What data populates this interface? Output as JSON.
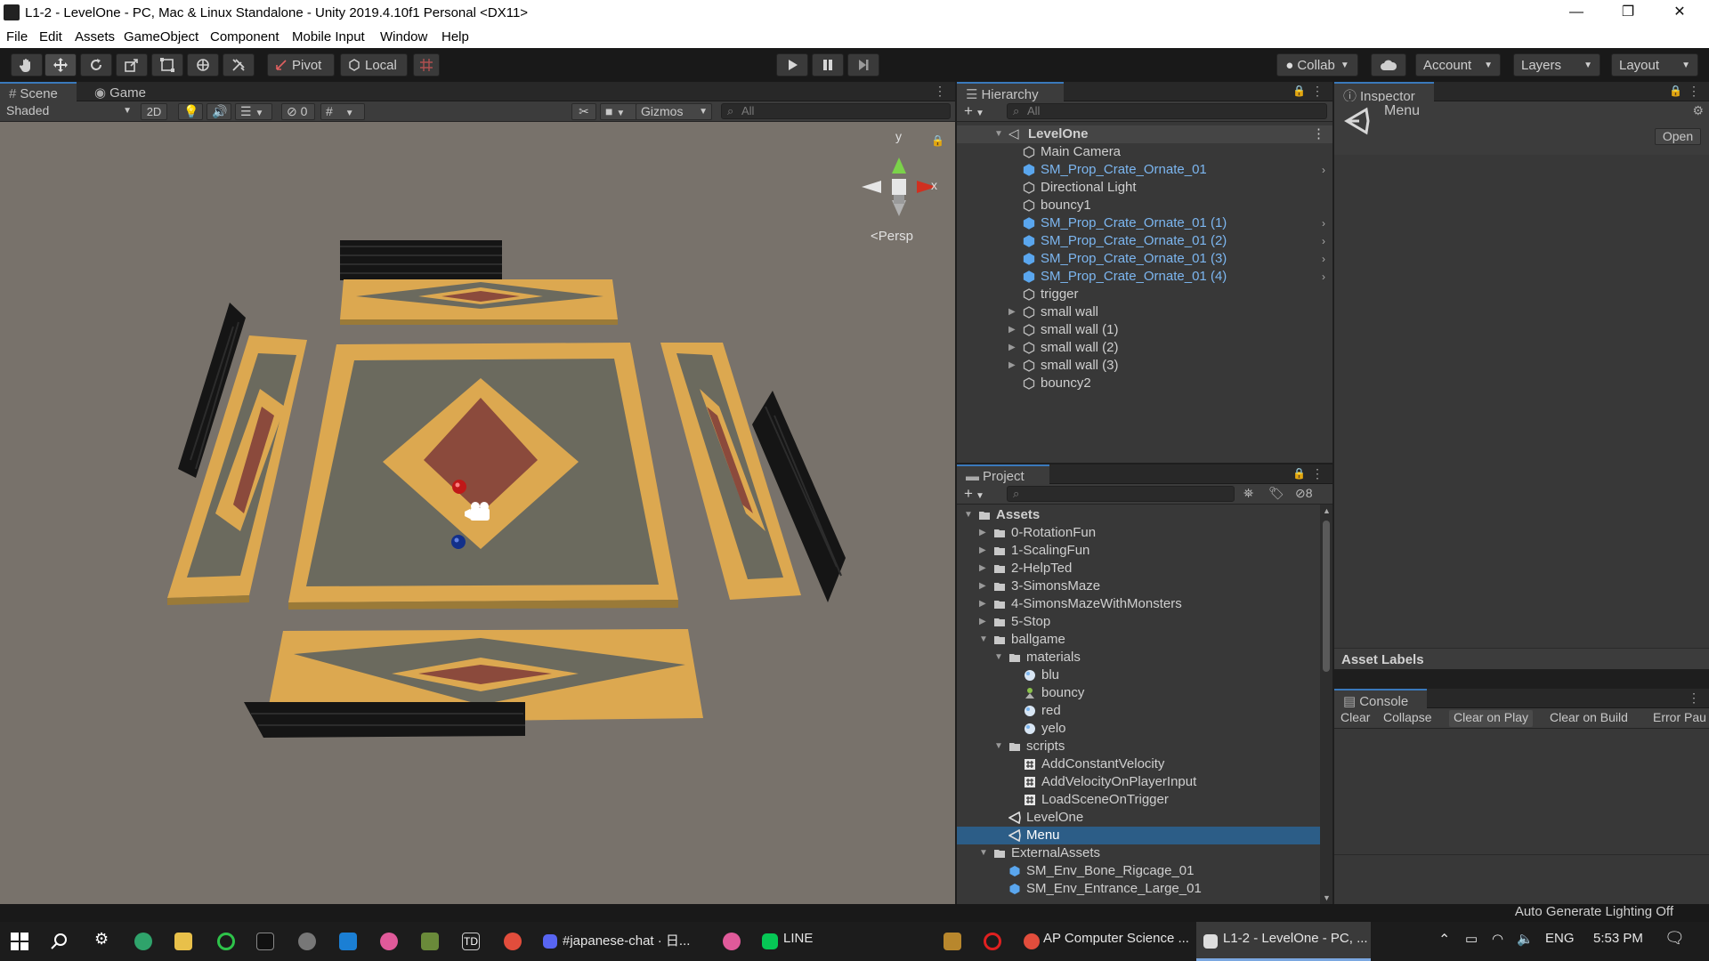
{
  "window": {
    "title": "L1-2 - LevelOne - PC, Mac & Linux Standalone - Unity 2019.4.10f1 Personal <DX11>",
    "minimize": "—",
    "maximize": "❐",
    "close": "✕"
  },
  "menu": [
    "File",
    "Edit",
    "Assets",
    "GameObject",
    "Component",
    "Mobile Input",
    "Window",
    "Help"
  ],
  "toolbar": {
    "pivot": "Pivot",
    "local": "Local",
    "collab": "Collab",
    "account": "Account",
    "layers": "Layers",
    "layout": "Layout"
  },
  "scene": {
    "tab_scene": "Scene",
    "tab_game": "Game",
    "shading": "Shaded",
    "mode2d": "2D",
    "hidden_count": "0",
    "gizmos": "Gizmos",
    "search_placeholder": "All",
    "persp": "Persp",
    "axis_y": "y",
    "axis_x": "x"
  },
  "hierarchy": {
    "tab": "Hierarchy",
    "search_placeholder": "All",
    "scene": "LevelOne",
    "items": [
      {
        "name": "Main Camera",
        "prefab": false,
        "expandable": false
      },
      {
        "name": "SM_Prop_Crate_Ornate_01",
        "prefab": true,
        "expandable": false
      },
      {
        "name": "Directional Light",
        "prefab": false,
        "expandable": false
      },
      {
        "name": "bouncy1",
        "prefab": false,
        "expandable": false
      },
      {
        "name": "SM_Prop_Crate_Ornate_01 (1)",
        "prefab": true,
        "expandable": false
      },
      {
        "name": "SM_Prop_Crate_Ornate_01 (2)",
        "prefab": true,
        "expandable": false
      },
      {
        "name": "SM_Prop_Crate_Ornate_01 (3)",
        "prefab": true,
        "expandable": false
      },
      {
        "name": "SM_Prop_Crate_Ornate_01 (4)",
        "prefab": true,
        "expandable": false
      },
      {
        "name": "trigger",
        "prefab": false,
        "expandable": false
      },
      {
        "name": "small wall",
        "prefab": false,
        "expandable": true
      },
      {
        "name": "small wall (1)",
        "prefab": false,
        "expandable": true
      },
      {
        "name": "small wall (2)",
        "prefab": false,
        "expandable": true
      },
      {
        "name": "small wall (3)",
        "prefab": false,
        "expandable": true
      },
      {
        "name": "bouncy2",
        "prefab": false,
        "expandable": false
      }
    ]
  },
  "project": {
    "tab": "Project",
    "hidden_count": "8",
    "tree": [
      {
        "name": "Assets",
        "depth": 0,
        "kind": "folder",
        "open": true
      },
      {
        "name": "0-RotationFun",
        "depth": 1,
        "kind": "folder",
        "open": false
      },
      {
        "name": "1-ScalingFun",
        "depth": 1,
        "kind": "folder",
        "open": false
      },
      {
        "name": "2-HelpTed",
        "depth": 1,
        "kind": "folder",
        "open": false
      },
      {
        "name": "3-SimonsMaze",
        "depth": 1,
        "kind": "folder",
        "open": false
      },
      {
        "name": "4-SimonsMazeWithMonsters",
        "depth": 1,
        "kind": "folder",
        "open": false
      },
      {
        "name": "5-Stop",
        "depth": 1,
        "kind": "folder",
        "open": false
      },
      {
        "name": "ballgame",
        "depth": 1,
        "kind": "folder",
        "open": true
      },
      {
        "name": "materials",
        "depth": 2,
        "kind": "folder",
        "open": true
      },
      {
        "name": "blu",
        "depth": 3,
        "kind": "material"
      },
      {
        "name": "bouncy",
        "depth": 3,
        "kind": "physics"
      },
      {
        "name": "red",
        "depth": 3,
        "kind": "material"
      },
      {
        "name": "yelo",
        "depth": 3,
        "kind": "material"
      },
      {
        "name": "scripts",
        "depth": 2,
        "kind": "folder",
        "open": true
      },
      {
        "name": "AddConstantVelocity",
        "depth": 3,
        "kind": "script"
      },
      {
        "name": "AddVelocityOnPlayerInput",
        "depth": 3,
        "kind": "script"
      },
      {
        "name": "LoadSceneOnTrigger",
        "depth": 3,
        "kind": "script"
      },
      {
        "name": "LevelOne",
        "depth": 2,
        "kind": "scene"
      },
      {
        "name": "Menu",
        "depth": 2,
        "kind": "scene",
        "selected": true
      },
      {
        "name": "ExternalAssets",
        "depth": 1,
        "kind": "folder",
        "open": true
      },
      {
        "name": "SM_Env_Bone_Rigcage_01",
        "depth": 2,
        "kind": "prefab"
      },
      {
        "name": "SM_Env_Entrance_Large_01",
        "depth": 2,
        "kind": "prefab"
      }
    ]
  },
  "inspector": {
    "tab": "Inspector",
    "asset_name": "Menu",
    "open_button": "Open",
    "asset_labels": "Asset Labels"
  },
  "console": {
    "tab": "Console",
    "buttons": [
      "Clear",
      "Collapse",
      "Clear on Play",
      "Clear on Build",
      "Error Pau"
    ]
  },
  "status": {
    "lighting": "Auto Generate Lighting Off"
  },
  "taskbar": {
    "items": [
      "#japanese-chat · 日...",
      "LINE",
      "AP Computer Science ...",
      "L1-2 - LevelOne - PC, ..."
    ],
    "td": "TD",
    "lang": "ENG",
    "time": "5:53 PM"
  },
  "colors": {
    "accent": "#3a79bb",
    "prefab_blue": "#7cb6f0",
    "selection": "#2c5d87",
    "scene_bg": "#78726b",
    "carpet_gold": "#dca850",
    "carpet_grey": "#6b6a5e",
    "carpet_brown": "#8b4a3c"
  }
}
